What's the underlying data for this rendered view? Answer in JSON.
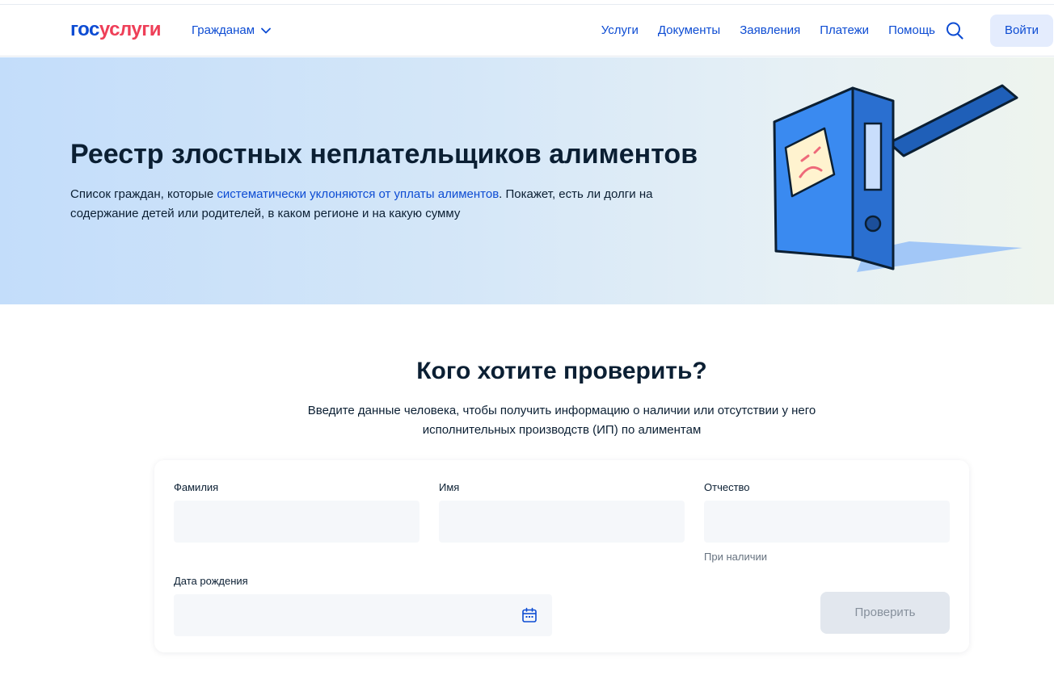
{
  "header": {
    "logo_part1": "гос",
    "logo_part2": "услуги",
    "audience_label": "Гражданам",
    "nav": [
      "Услуги",
      "Документы",
      "Заявления",
      "Платежи",
      "Помощь"
    ],
    "login_label": "Войти"
  },
  "hero": {
    "title": "Реестр злостных неплательщиков алиментов",
    "desc_before": "Список граждан, которые ",
    "desc_link": "систематически уклоняются от уплаты алиментов",
    "desc_after": ". Покажет, есть ли долги на содержание детей или родителей, в каком регионе и на какую сумму"
  },
  "section": {
    "title": "Кого хотите проверить?",
    "subtitle_line1": "Введите данные человека, чтобы получить информацию о наличии или отсутствии у него",
    "subtitle_line2": "исполнительных производств (ИП) по алиментам"
  },
  "form": {
    "surname_label": "Фамилия",
    "surname_value": "",
    "name_label": "Имя",
    "name_value": "",
    "patronymic_label": "Отчество",
    "patronymic_value": "",
    "patronymic_hint": "При наличии",
    "birthdate_label": "Дата рождения",
    "birthdate_value": "",
    "submit_label": "Проверить"
  },
  "colors": {
    "brand_blue": "#0d4cd3",
    "brand_red": "#ee3f58",
    "input_bg": "#f5f7fa",
    "disabled_button": "#e2e7ee"
  }
}
